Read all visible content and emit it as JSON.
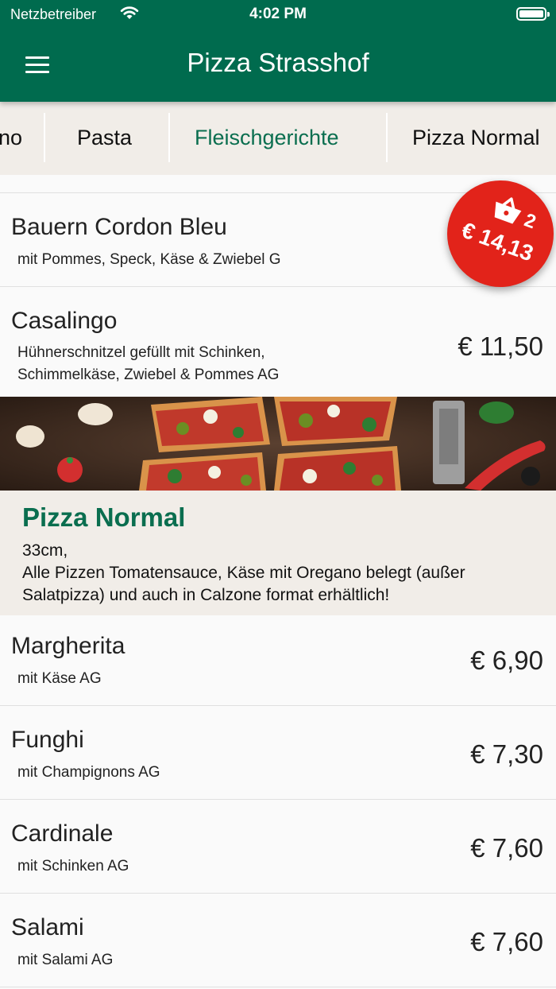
{
  "status_bar": {
    "carrier": "Netzbetreiber",
    "time": "4:02 PM"
  },
  "app_bar": {
    "title": "Pizza Strasshof"
  },
  "tabs": [
    {
      "label": "no"
    },
    {
      "label": "Pasta"
    },
    {
      "label": "Fleischgerichte",
      "active": true
    },
    {
      "label": "Pizza Normal"
    }
  ],
  "items_top": [
    {
      "name": "Bauern Cordon Bleu",
      "desc": "mit Pommes, Speck, Käse & Zwiebel G",
      "price": ""
    },
    {
      "name": "Casalingo",
      "desc": "Hühnerschnitzel gefüllt mit Schinken,\nSchimmelkäse, Zwiebel & Pommes AG",
      "price": "€ 11,50"
    }
  ],
  "section": {
    "title": "Pizza Normal",
    "description": "33cm,\nAlle Pizzen Tomatensauce, Käse mit Oregano belegt (außer\nSalatpizza) und auch in Calzone format erhältlich!"
  },
  "items_pizza": [
    {
      "name": "Margherita",
      "desc": "mit Käse AG",
      "price": "€ 6,90"
    },
    {
      "name": "Funghi",
      "desc": "mit Champignons AG",
      "price": "€ 7,30"
    },
    {
      "name": "Cardinale",
      "desc": "mit Schinken AG",
      "price": "€ 7,60"
    },
    {
      "name": "Salami",
      "desc": "mit Salami AG",
      "price": "€ 7,60"
    }
  ],
  "cart": {
    "count": "2",
    "total": "€ 14,13"
  },
  "colors": {
    "primary": "#006b4e",
    "accent_text": "#0a6e4f",
    "cart": "#e2231a",
    "tab_bg": "#f1ede8"
  },
  "icons": [
    "menu-icon",
    "wifi-icon",
    "battery-icon",
    "shopping-basket-icon"
  ]
}
